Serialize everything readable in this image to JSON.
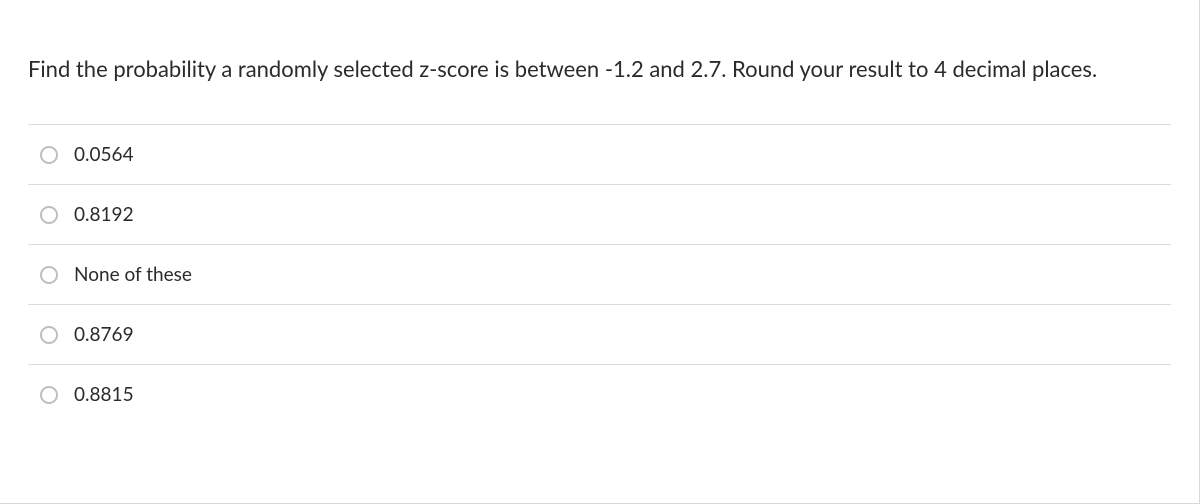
{
  "question": {
    "text": "Find the probability a randomly selected z-score is between -1.2 and 2.7.  Round your result to 4 decimal places."
  },
  "options": [
    {
      "label": "0.0564"
    },
    {
      "label": "0.8192"
    },
    {
      "label": "None of these"
    },
    {
      "label": "0.8769"
    },
    {
      "label": "0.8815"
    }
  ]
}
